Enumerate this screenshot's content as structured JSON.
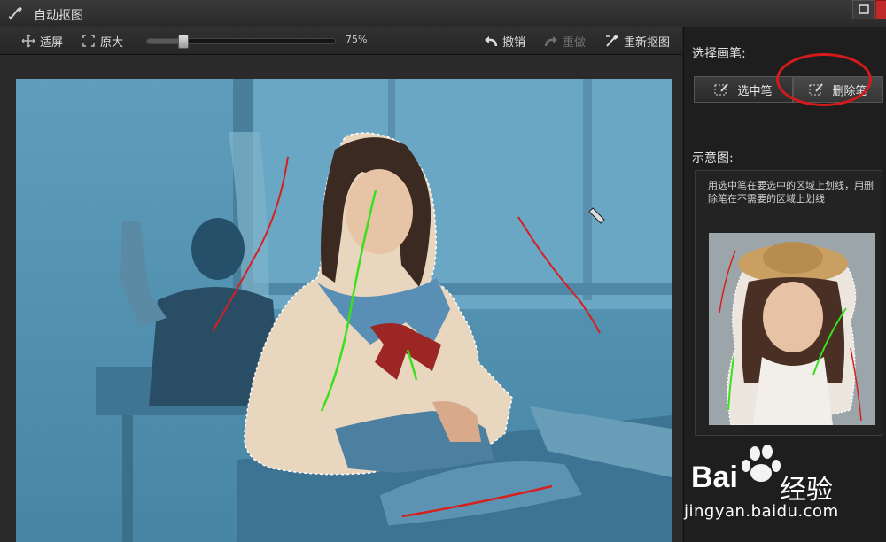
{
  "window": {
    "title": "自动抠图"
  },
  "toolbar": {
    "fit_label": "适屏",
    "original_label": "原大",
    "zoom_percent": "75%",
    "zoom_value": 0.19,
    "undo_label": "撤销",
    "redo_label": "重做",
    "recut_label": "重新抠图"
  },
  "sidebar": {
    "select_pen_heading": "选择画笔:",
    "pen_select_label": "选中笔",
    "pen_delete_label": "删除笔",
    "diagram_heading": "示意图:",
    "diagram_hint": "用选中笔在要选中的区域上划线，用删除笔在不需要的区域上划线"
  },
  "watermark": {
    "logo": "Bai",
    "logo_cn": "经验",
    "url": "jingyan.baidu.com"
  },
  "colors": {
    "highlight_ellipse": "#d41a1a",
    "select_stroke": "#39e01e",
    "delete_stroke": "#d62020",
    "photo_overlay": "#4f93b5"
  }
}
